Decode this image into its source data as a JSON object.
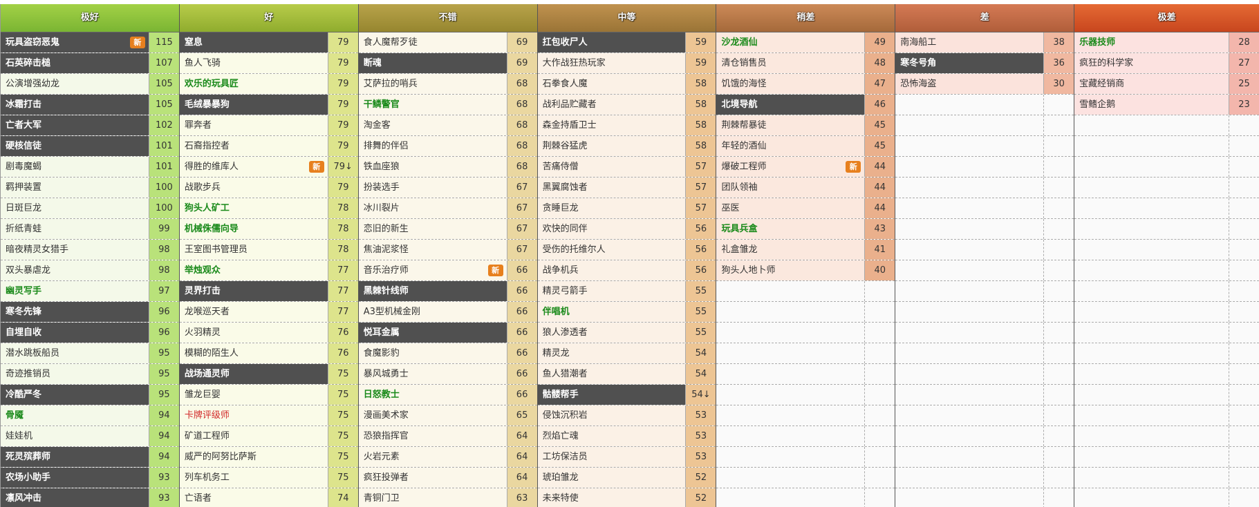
{
  "badge_new": "新",
  "columns": [
    {
      "title": "极好",
      "header_colors": [
        "#7ab533",
        "#a3d146"
      ],
      "light": "#f4f9e9",
      "score": "#b9e27a",
      "rows": [
        {
          "name": "玩具盗窃恶鬼",
          "score": "115",
          "style": "dark",
          "badge": true
        },
        {
          "name": "石英碎击槌",
          "score": "107",
          "style": "dark"
        },
        {
          "name": "公演增强幼龙",
          "score": "105",
          "style": "normal"
        },
        {
          "name": "冰霜打击",
          "score": "105",
          "style": "dark"
        },
        {
          "name": "亡者大军",
          "score": "102",
          "style": "dark"
        },
        {
          "name": "硬核信徒",
          "score": "101",
          "style": "dark"
        },
        {
          "name": "剧毒魔蝎",
          "score": "101",
          "style": "normal"
        },
        {
          "name": "羁押装置",
          "score": "100",
          "style": "normal"
        },
        {
          "name": "日斑巨龙",
          "score": "100",
          "style": "normal"
        },
        {
          "name": "折纸青蛙",
          "score": "99",
          "style": "normal"
        },
        {
          "name": "暗夜精灵女猎手",
          "score": "98",
          "style": "normal"
        },
        {
          "name": "双头暴虐龙",
          "score": "98",
          "style": "normal"
        },
        {
          "name": "幽灵写手",
          "score": "97",
          "style": "green"
        },
        {
          "name": "寒冬先锋",
          "score": "96",
          "style": "dark"
        },
        {
          "name": "自埋自收",
          "score": "96",
          "style": "dark"
        },
        {
          "name": "潜水跳板船员",
          "score": "95",
          "style": "normal"
        },
        {
          "name": "奇迹推销员",
          "score": "95",
          "style": "normal"
        },
        {
          "name": "冷酷严冬",
          "score": "95",
          "style": "dark"
        },
        {
          "name": "骨魇",
          "score": "94",
          "style": "green"
        },
        {
          "name": "娃娃机",
          "score": "94",
          "style": "normal"
        },
        {
          "name": "死灵殡葬师",
          "score": "94",
          "style": "dark"
        },
        {
          "name": "农场小助手",
          "score": "93",
          "style": "dark"
        },
        {
          "name": "凛风冲击",
          "score": "93",
          "style": "dark"
        }
      ]
    },
    {
      "title": "好",
      "header_colors": [
        "#8fac2e",
        "#b8cc4a"
      ],
      "light": "#fafbe8",
      "score": "#dde48c",
      "rows": [
        {
          "name": "窒息",
          "score": "79",
          "style": "dark"
        },
        {
          "name": "鱼人飞骑",
          "score": "79",
          "style": "normal"
        },
        {
          "name": "欢乐的玩具匠",
          "score": "79",
          "style": "green"
        },
        {
          "name": "毛绒暴暴狗",
          "score": "79",
          "style": "dark"
        },
        {
          "name": "罪奔者",
          "score": "79",
          "style": "normal"
        },
        {
          "name": "石裔指控者",
          "score": "79",
          "style": "normal"
        },
        {
          "name": "得胜的维库人",
          "score": "79↓",
          "style": "normal",
          "badge": true
        },
        {
          "name": "战歌步兵",
          "score": "79",
          "style": "normal"
        },
        {
          "name": "狗头人矿工",
          "score": "78",
          "style": "green"
        },
        {
          "name": "机械侏儒向导",
          "score": "78",
          "style": "green"
        },
        {
          "name": "王室图书管理员",
          "score": "78",
          "style": "normal"
        },
        {
          "name": "举烛观众",
          "score": "77",
          "style": "green"
        },
        {
          "name": "灵界打击",
          "score": "77",
          "style": "dark"
        },
        {
          "name": "龙喉巡天者",
          "score": "77",
          "style": "normal"
        },
        {
          "name": "火羽精灵",
          "score": "76",
          "style": "normal"
        },
        {
          "name": "模糊的陌生人",
          "score": "76",
          "style": "normal"
        },
        {
          "name": "战场通灵师",
          "score": "75",
          "style": "dark"
        },
        {
          "name": "雏龙巨婴",
          "score": "75",
          "style": "normal"
        },
        {
          "name": "卡牌评级师",
          "score": "75",
          "style": "red"
        },
        {
          "name": "矿道工程师",
          "score": "75",
          "style": "normal"
        },
        {
          "name": "威严的阿努比萨斯",
          "score": "75",
          "style": "normal"
        },
        {
          "name": "列车机务工",
          "score": "75",
          "style": "normal"
        },
        {
          "name": "亡语者",
          "score": "74",
          "style": "normal"
        }
      ]
    },
    {
      "title": "不错",
      "header_colors": [
        "#96862f",
        "#b8a34a"
      ],
      "light": "#fbf7ea",
      "score": "#ead7a0",
      "rows": [
        {
          "name": "食人魔帮歹徒",
          "score": "69",
          "style": "normal"
        },
        {
          "name": "断魂",
          "score": "69",
          "style": "dark"
        },
        {
          "name": "艾萨拉的哨兵",
          "score": "68",
          "style": "normal"
        },
        {
          "name": "干鳞警官",
          "score": "68",
          "style": "green"
        },
        {
          "name": "淘金客",
          "score": "68",
          "style": "normal"
        },
        {
          "name": "排舞的伴侣",
          "score": "68",
          "style": "normal"
        },
        {
          "name": "铁血座狼",
          "score": "68",
          "style": "normal"
        },
        {
          "name": "扮装选手",
          "score": "67",
          "style": "normal"
        },
        {
          "name": "冰川裂片",
          "score": "67",
          "style": "normal"
        },
        {
          "name": "恋旧的新生",
          "score": "67",
          "style": "normal"
        },
        {
          "name": "焦油泥浆怪",
          "score": "67",
          "style": "normal"
        },
        {
          "name": "音乐治疗师",
          "score": "66",
          "style": "normal",
          "badge": true
        },
        {
          "name": "黑棘针线师",
          "score": "66",
          "style": "dark"
        },
        {
          "name": "A3型机械金刚",
          "score": "66",
          "style": "normal"
        },
        {
          "name": "悦耳金属",
          "score": "66",
          "style": "dark"
        },
        {
          "name": "食魔影豹",
          "score": "66",
          "style": "normal"
        },
        {
          "name": "暴风城勇士",
          "score": "66",
          "style": "normal"
        },
        {
          "name": "日怒教士",
          "score": "66",
          "style": "green"
        },
        {
          "name": "漫画美术家",
          "score": "65",
          "style": "normal"
        },
        {
          "name": "恐狼指挥官",
          "score": "64",
          "style": "normal"
        },
        {
          "name": "火岩元素",
          "score": "64",
          "style": "normal"
        },
        {
          "name": "疯狂投弹者",
          "score": "64",
          "style": "normal"
        },
        {
          "name": "青铜门卫",
          "score": "63",
          "style": "normal"
        }
      ]
    },
    {
      "title": "中等",
      "header_colors": [
        "#9a7436",
        "#c0924f"
      ],
      "light": "#fbf1e6",
      "score": "#edc594",
      "rows": [
        {
          "name": "扛包收尸人",
          "score": "59",
          "style": "dark"
        },
        {
          "name": "大作战狂热玩家",
          "score": "59",
          "style": "normal"
        },
        {
          "name": "石拳食人魔",
          "score": "58",
          "style": "normal"
        },
        {
          "name": "战利品贮藏者",
          "score": "58",
          "style": "normal"
        },
        {
          "name": "森金持盾卫士",
          "score": "58",
          "style": "normal"
        },
        {
          "name": "荆棘谷猛虎",
          "score": "58",
          "style": "normal"
        },
        {
          "name": "苦痛侍僧",
          "score": "57",
          "style": "normal"
        },
        {
          "name": "黑翼腐蚀者",
          "score": "57",
          "style": "normal"
        },
        {
          "name": "贪睡巨龙",
          "score": "57",
          "style": "normal"
        },
        {
          "name": "欢快的同伴",
          "score": "56",
          "style": "normal"
        },
        {
          "name": "受伤的托维尔人",
          "score": "56",
          "style": "normal"
        },
        {
          "name": "战争机兵",
          "score": "56",
          "style": "normal"
        },
        {
          "name": "精灵弓箭手",
          "score": "55",
          "style": "normal"
        },
        {
          "name": "伴唱机",
          "score": "55",
          "style": "green"
        },
        {
          "name": "狼人渗透者",
          "score": "55",
          "style": "normal"
        },
        {
          "name": "精灵龙",
          "score": "54",
          "style": "normal"
        },
        {
          "name": "鱼人猎潮者",
          "score": "54",
          "style": "normal"
        },
        {
          "name": "骷髅帮手",
          "score": "54↓",
          "style": "dark"
        },
        {
          "name": "侵蚀沉积岩",
          "score": "53",
          "style": "normal"
        },
        {
          "name": "烈焰亡魂",
          "score": "53",
          "style": "normal"
        },
        {
          "name": "工坊保洁员",
          "score": "53",
          "style": "normal"
        },
        {
          "name": "琥珀雏龙",
          "score": "52",
          "style": "normal"
        },
        {
          "name": "未来特使",
          "score": "52",
          "style": "normal"
        }
      ]
    },
    {
      "title": "稍差",
      "header_colors": [
        "#a5693a",
        "#cc8a58"
      ],
      "light": "#fbe8de",
      "score": "#eab08c",
      "rows": [
        {
          "name": "沙龙酒仙",
          "score": "49",
          "style": "green"
        },
        {
          "name": "清仓销售员",
          "score": "48",
          "style": "normal"
        },
        {
          "name": "饥饿的海怪",
          "score": "47",
          "style": "normal"
        },
        {
          "name": "北境导航",
          "score": "46",
          "style": "dark"
        },
        {
          "name": "荆棘帮暴徒",
          "score": "45",
          "style": "normal"
        },
        {
          "name": "年轻的酒仙",
          "score": "45",
          "style": "normal"
        },
        {
          "name": "爆破工程师",
          "score": "44",
          "style": "normal",
          "badge": true
        },
        {
          "name": "团队领袖",
          "score": "44",
          "style": "normal"
        },
        {
          "name": "巫医",
          "score": "44",
          "style": "normal"
        },
        {
          "name": "玩具兵盒",
          "score": "43",
          "style": "green"
        },
        {
          "name": "礼盒雏龙",
          "score": "41",
          "style": "normal"
        },
        {
          "name": "狗头人地卜师",
          "score": "40",
          "style": "normal"
        }
      ]
    },
    {
      "title": "差",
      "header_colors": [
        "#b05e3a",
        "#d57a55"
      ],
      "light": "#fbe3dc",
      "score": "#f0b8a0",
      "rows": [
        {
          "name": "南海船工",
          "score": "38",
          "style": "normal"
        },
        {
          "name": "寒冬号角",
          "score": "36",
          "style": "dark"
        },
        {
          "name": "恐怖海盗",
          "score": "30",
          "style": "normal"
        }
      ]
    },
    {
      "title": "极差",
      "header_colors": [
        "#c8461e",
        "#e56a34"
      ],
      "light": "#fce2e0",
      "score": "#f3b6ac",
      "rows": [
        {
          "name": "乐器技师",
          "score": "28",
          "style": "green"
        },
        {
          "name": "疯狂的科学家",
          "score": "27",
          "style": "normal"
        },
        {
          "name": "宝藏经销商",
          "score": "25",
          "style": "normal"
        },
        {
          "name": "雪鳍企鹅",
          "score": "23",
          "style": "normal"
        }
      ]
    }
  ]
}
